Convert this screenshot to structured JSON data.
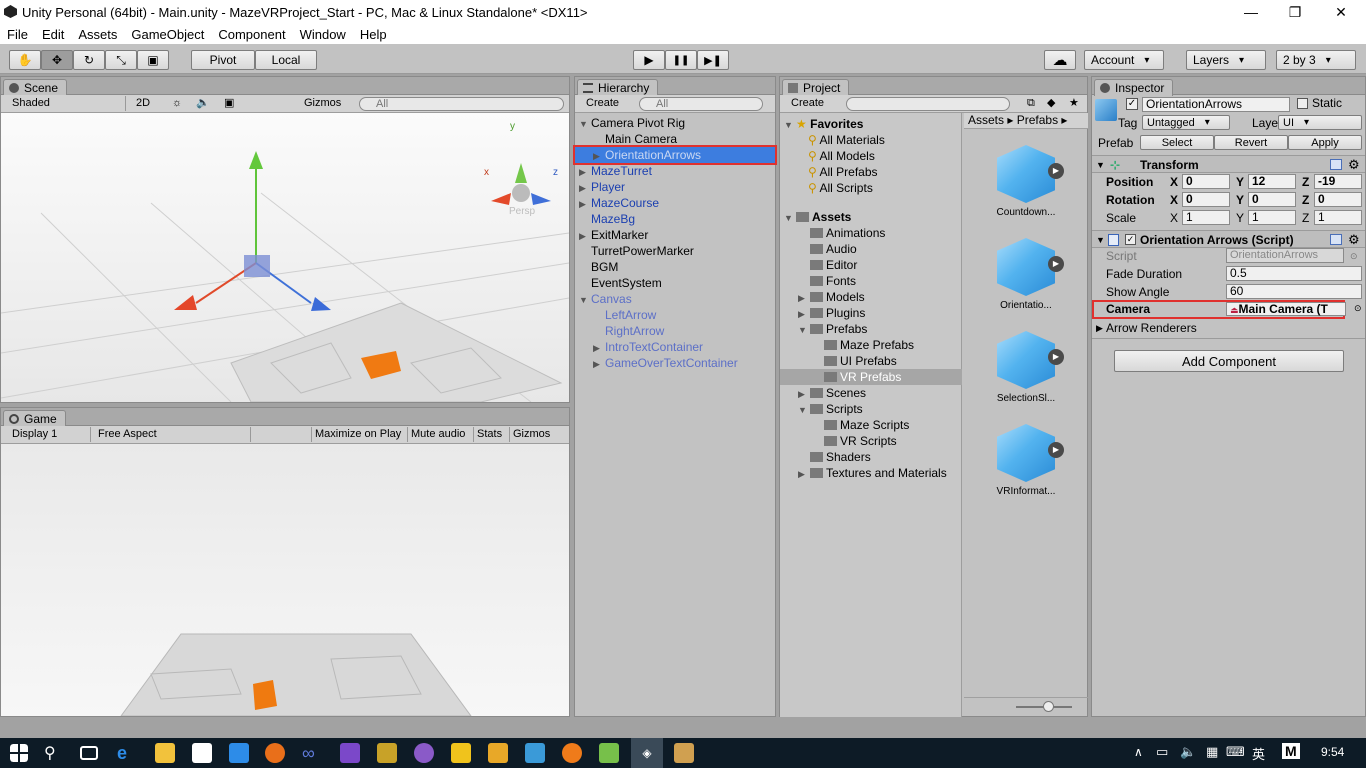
{
  "window": {
    "title": "Unity Personal (64bit) - Main.unity - MazeVRProject_Start - PC, Mac & Linux Standalone* <DX11>",
    "minimize": "—",
    "restore": "❐",
    "close": "✕"
  },
  "menu": [
    "File",
    "Edit",
    "Assets",
    "GameObject",
    "Component",
    "Window",
    "Help"
  ],
  "toolbar": {
    "tools": [
      "✋",
      "✥",
      "↻",
      "⤡",
      "▣"
    ],
    "pivot": "Pivot",
    "local": "Local",
    "play": "▶",
    "pause": "❚❚",
    "step": "▶❚",
    "cloud": "☁",
    "account": "Account",
    "layers": "Layers",
    "layout": "2 by 3"
  },
  "scene": {
    "tab": "Scene",
    "shading": "Shaded",
    "mode2d": "2D",
    "gizmos": "Gizmos",
    "search": "All",
    "persp": "Persp",
    "axis_x": "x",
    "axis_y": "y",
    "axis_z": "z"
  },
  "game": {
    "tab": "Game",
    "display": "Display 1",
    "aspect": "Free Aspect",
    "maximize": "Maximize on Play",
    "mute": "Mute audio",
    "stats": "Stats",
    "gizmos": "Gizmos"
  },
  "hierarchy": {
    "tab": "Hierarchy",
    "create": "Create",
    "search": "All",
    "items": [
      {
        "label": "Camera Pivot Rig",
        "depth": 0,
        "tri": "▼",
        "style": "normal"
      },
      {
        "label": "Main Camera",
        "depth": 1,
        "tri": "",
        "style": "normal"
      },
      {
        "label": "OrientationArrows",
        "depth": 1,
        "tri": "▶",
        "style": "selected"
      },
      {
        "label": "MazeTurret",
        "depth": 0,
        "tri": "▶",
        "style": "blue"
      },
      {
        "label": "Player",
        "depth": 0,
        "tri": "▶",
        "style": "blue"
      },
      {
        "label": "MazeCourse",
        "depth": 0,
        "tri": "▶",
        "style": "blue"
      },
      {
        "label": "MazeBg",
        "depth": 0,
        "tri": "",
        "style": "blue"
      },
      {
        "label": "ExitMarker",
        "depth": 0,
        "tri": "▶",
        "style": "normal"
      },
      {
        "label": "TurretPowerMarker",
        "depth": 0,
        "tri": "",
        "style": "normal"
      },
      {
        "label": "BGM",
        "depth": 0,
        "tri": "",
        "style": "normal"
      },
      {
        "label": "EventSystem",
        "depth": 0,
        "tri": "",
        "style": "normal"
      },
      {
        "label": "Canvas",
        "depth": 0,
        "tri": "▼",
        "style": "lblue"
      },
      {
        "label": "LeftArrow",
        "depth": 1,
        "tri": "",
        "style": "lblue"
      },
      {
        "label": "RightArrow",
        "depth": 1,
        "tri": "",
        "style": "lblue"
      },
      {
        "label": "IntroTextContainer",
        "depth": 1,
        "tri": "▶",
        "style": "lblue"
      },
      {
        "label": "GameOverTextContainer",
        "depth": 1,
        "tri": "▶",
        "style": "lblue"
      }
    ]
  },
  "project": {
    "tab": "Project",
    "create": "Create",
    "favorites_label": "Favorites",
    "favorites": [
      "All Materials",
      "All Models",
      "All Prefabs",
      "All Scripts"
    ],
    "tree": [
      {
        "label": "Assets",
        "depth": 0,
        "tri": "▼",
        "bold": true
      },
      {
        "label": "Animations",
        "depth": 1,
        "tri": ""
      },
      {
        "label": "Audio",
        "depth": 1,
        "tri": ""
      },
      {
        "label": "Editor",
        "depth": 1,
        "tri": ""
      },
      {
        "label": "Fonts",
        "depth": 1,
        "tri": ""
      },
      {
        "label": "Models",
        "depth": 1,
        "tri": "▶"
      },
      {
        "label": "Plugins",
        "depth": 1,
        "tri": "▶"
      },
      {
        "label": "Prefabs",
        "depth": 1,
        "tri": "▼"
      },
      {
        "label": "Maze Prefabs",
        "depth": 2,
        "tri": ""
      },
      {
        "label": "UI Prefabs",
        "depth": 2,
        "tri": ""
      },
      {
        "label": "VR Prefabs",
        "depth": 2,
        "tri": "",
        "selected": true
      },
      {
        "label": "Scenes",
        "depth": 1,
        "tri": "▶"
      },
      {
        "label": "Scripts",
        "depth": 1,
        "tri": "▼"
      },
      {
        "label": "Maze Scripts",
        "depth": 2,
        "tri": ""
      },
      {
        "label": "VR Scripts",
        "depth": 2,
        "tri": ""
      },
      {
        "label": "Shaders",
        "depth": 1,
        "tri": ""
      },
      {
        "label": "Textures and Materials",
        "depth": 1,
        "tri": "▶"
      }
    ],
    "breadcrumb": [
      "Assets",
      "Prefabs"
    ],
    "assets": [
      "Countdown...",
      "Orientatio...",
      "SelectionSl...",
      "VRInformat..."
    ]
  },
  "inspector": {
    "tab": "Inspector",
    "name": "OrientationArrows",
    "static": "Static",
    "tag_label": "Tag",
    "tag": "Untagged",
    "layer_label": "Layer",
    "layer": "UI",
    "prefab_label": "Prefab",
    "select": "Select",
    "revert": "Revert",
    "apply": "Apply",
    "transform": {
      "title": "Transform",
      "position": {
        "label": "Position",
        "x": "0",
        "y": "12",
        "z": "-19"
      },
      "rotation": {
        "label": "Rotation",
        "x": "0",
        "y": "0",
        "z": "0"
      },
      "scale": {
        "label": "Scale",
        "x": "1",
        "y": "1",
        "z": "1"
      }
    },
    "script": {
      "title": "Orientation Arrows (Script)",
      "script_label": "Script",
      "script_value": "OrientationArrows",
      "fade_label": "Fade Duration",
      "fade_value": "0.5",
      "angle_label": "Show Angle",
      "angle_value": "60",
      "camera_label": "Camera",
      "camera_value": "Main Camera (T",
      "renderers_label": "Arrow Renderers"
    },
    "add_component": "Add Component"
  },
  "taskbar": {
    "time": "9:54",
    "ime": "英",
    "m": "M"
  },
  "colors": {
    "selection": "#3d7ddf",
    "highlight_border": "#e0312e",
    "panel": "#c2c2c2",
    "taskbar": "#0d1b26"
  }
}
